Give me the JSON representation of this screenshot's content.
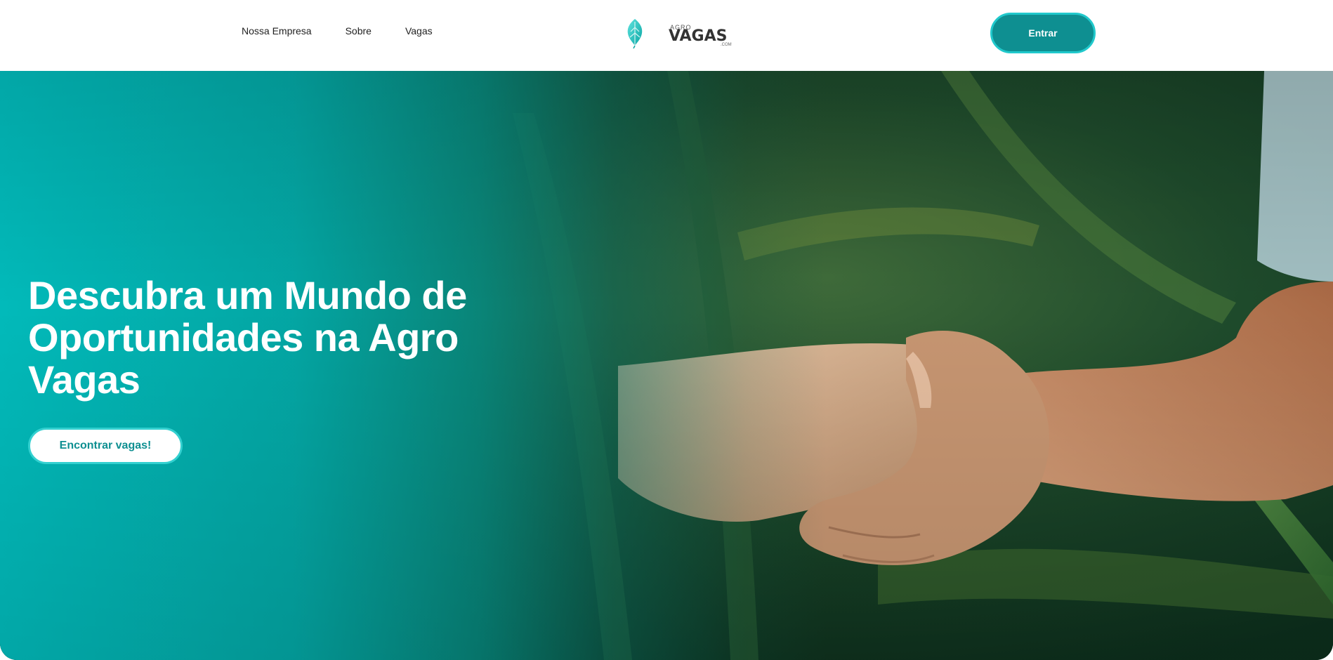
{
  "header": {
    "nav": [
      {
        "label": "Nossa Empresa"
      },
      {
        "label": "Sobre"
      },
      {
        "label": "Vagas"
      }
    ],
    "logo": {
      "small_text": "AGRO",
      "big_text": "VAGAS",
      "suffix": ".COM",
      "icon": "leaf-logo-icon"
    },
    "login_label": "Entrar"
  },
  "hero": {
    "title": "Descubra um Mundo de Oportunidades na Agro Vagas",
    "cta_label": "Encontrar vagas!",
    "background_image": "handshake-in-green-field",
    "colors": {
      "teal": "#02baba",
      "teal_dark": "#0e8f91",
      "teal_border": "#21c9cc"
    }
  }
}
